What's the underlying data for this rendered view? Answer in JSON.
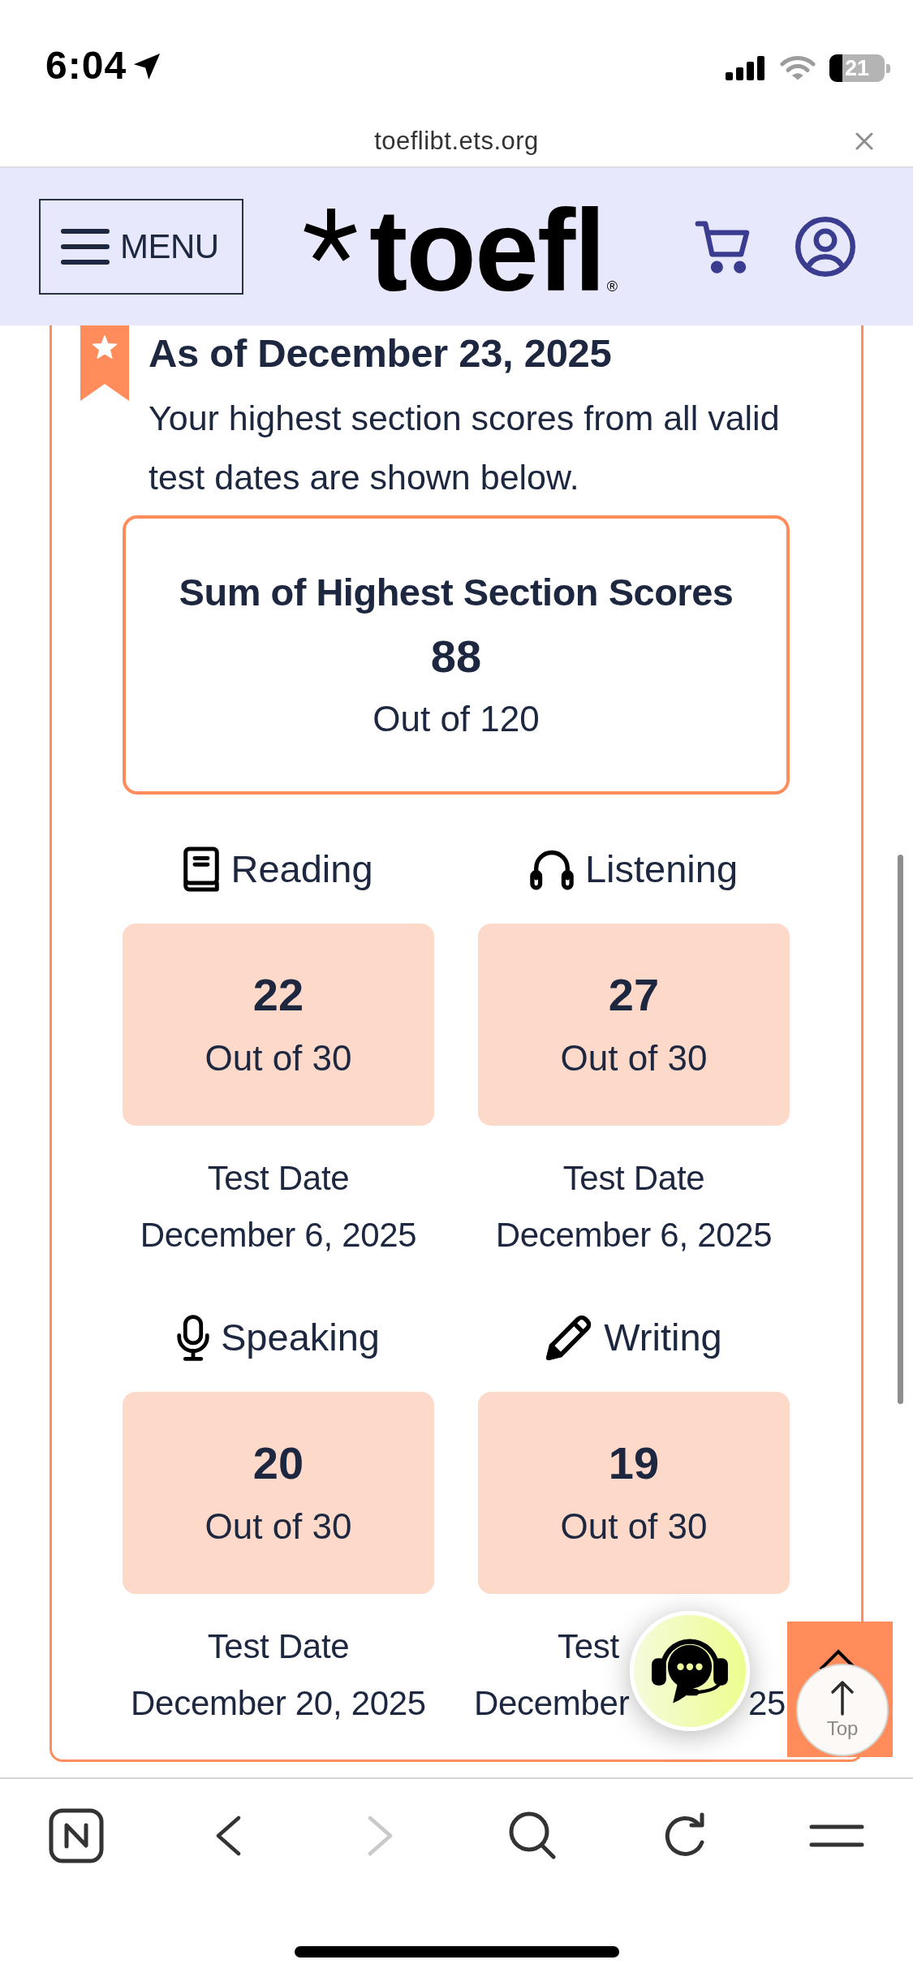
{
  "status_bar": {
    "time": "6:04",
    "battery": "21"
  },
  "address_bar": {
    "url": "toeflibt.ets.org"
  },
  "header": {
    "menu_label": "MENU",
    "logo": "toefl",
    "logo_mark": "®"
  },
  "scores": {
    "title": "As of December 23, 2025",
    "description": "Your highest section scores from all valid test dates are shown below.",
    "total": {
      "label": "Sum of Highest Section Scores",
      "score": "88",
      "out_of": "Out of 120"
    },
    "sections": [
      {
        "kind": "reading",
        "name": "Reading",
        "score": "22",
        "out_of": "Out of 30",
        "overlapped": false,
        "date_label": [
          "Test Date"
        ],
        "date": [
          "December 6, 2025"
        ]
      },
      {
        "kind": "listening",
        "name": "Listening",
        "score": "27",
        "out_of": "Out of 30",
        "overlapped": false,
        "date_label": [
          "Test Date"
        ],
        "date": [
          "December 6, 2025"
        ]
      },
      {
        "kind": "speaking",
        "name": "Speaking",
        "score": "20",
        "out_of": "Out of 30",
        "overlapped": false,
        "date_label": [
          "Test Date"
        ],
        "date": [
          "December 20, 2025"
        ]
      },
      {
        "kind": "writing",
        "name": "Writing",
        "score": "19",
        "out_of": "Out of 30",
        "overlapped": true,
        "date_label": [
          "Test"
        ],
        "date": [
          "December",
          "25"
        ]
      }
    ]
  },
  "scroll_top": {
    "label": "Top"
  },
  "toolbar": [
    {
      "kind": "tabs",
      "disabled": false
    },
    {
      "kind": "back",
      "disabled": false
    },
    {
      "kind": "forward",
      "disabled": true
    },
    {
      "kind": "search",
      "disabled": false
    },
    {
      "kind": "reload",
      "disabled": false
    },
    {
      "kind": "menu",
      "disabled": false
    }
  ]
}
